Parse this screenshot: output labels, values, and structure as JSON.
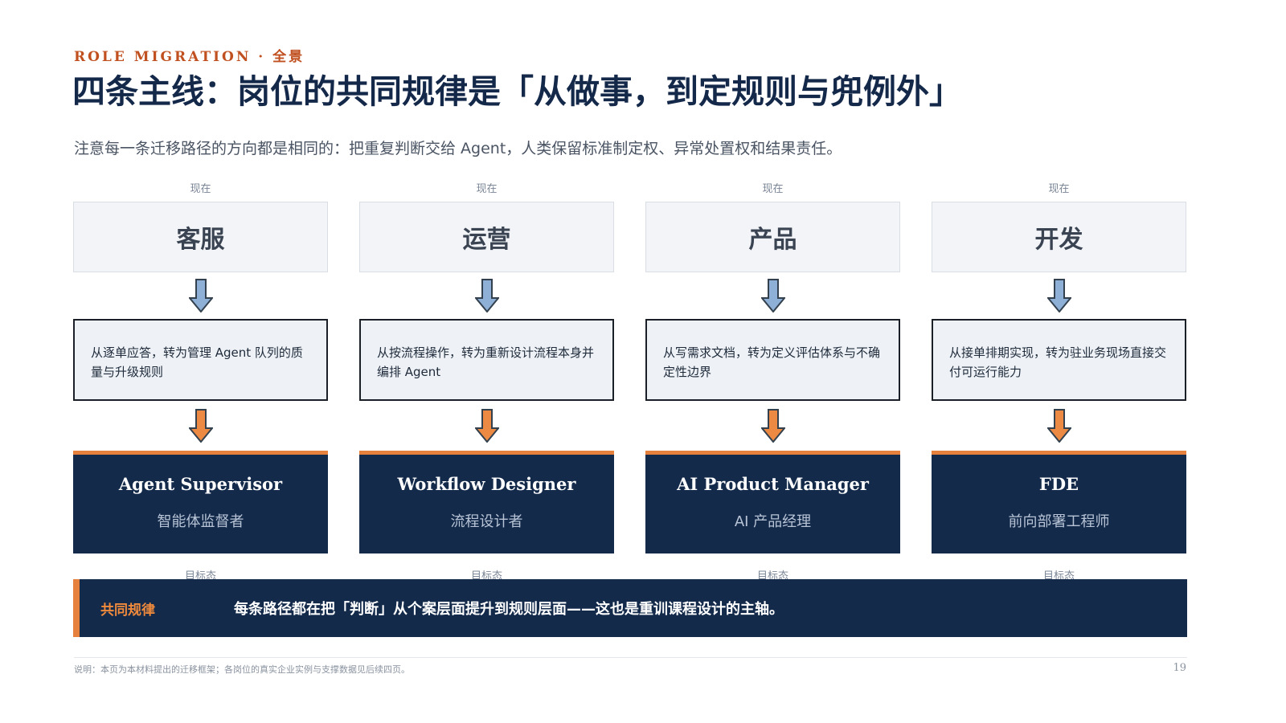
{
  "header": {
    "eyebrow": "ROLE MIGRATION · 全景",
    "title": "四条主线：岗位的共同规律是「从做事，到定规则与兜例外」",
    "subtitle": "注意每一条迁移路径的方向都是相同的：把重复判断交给 Agent，人类保留标准制定权、异常处置权和结果责任。"
  },
  "columns": [
    {
      "now_label": "现在",
      "now_role": "客服",
      "description": "从逐单应答，转为管理 Agent 队列的质量与升级规则",
      "target_en": "Agent Supervisor",
      "target_zh": "智能体监督者",
      "target_label": "目标态"
    },
    {
      "now_label": "现在",
      "now_role": "运营",
      "description": "从按流程操作，转为重新设计流程本身并编排 Agent",
      "target_en": "Workflow Designer",
      "target_zh": "流程设计者",
      "target_label": "目标态"
    },
    {
      "now_label": "现在",
      "now_role": "产品",
      "description": "从写需求文档，转为定义评估体系与不确定性边界",
      "target_en": "AI Product Manager",
      "target_zh": "AI 产品经理",
      "target_label": "目标态"
    },
    {
      "now_label": "现在",
      "now_role": "开发",
      "description": "从接单排期实现，转为驻业务现场直接交付可运行能力",
      "target_en": "FDE",
      "target_zh": "前向部署工程师",
      "target_label": "目标态"
    }
  ],
  "law": {
    "label": "共同规律",
    "text": "每条路径都在把「判断」从个案层面提升到规则层面——这也是重训课程设计的主轴。"
  },
  "footer": {
    "note": "说明：本页为本材料提出的迁移框架；各岗位的真实企业实例与支撑数据见后续四页。",
    "page": "19"
  },
  "colors": {
    "accent": "#e5813d",
    "navy": "#132a4b",
    "blue_arrow": "#8fb0d6",
    "orange_arrow": "#ec8a44"
  }
}
